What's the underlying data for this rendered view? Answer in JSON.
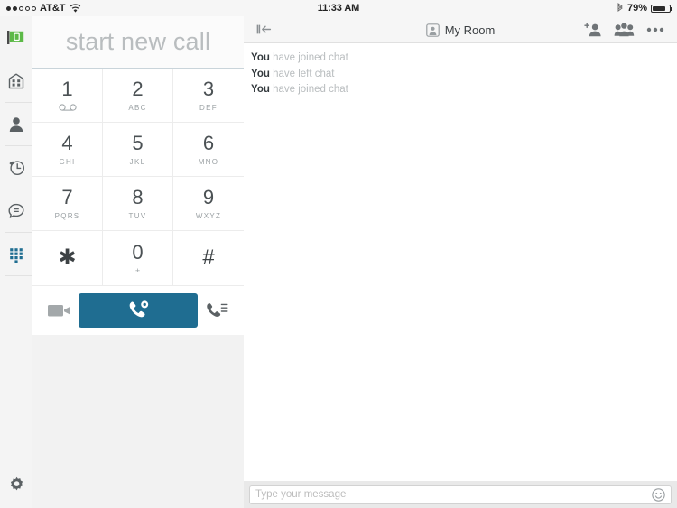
{
  "statusbar": {
    "carrier": "AT&T",
    "signal_dots_filled": 2,
    "signal_dots_total": 5,
    "wifi_icon": "wifi-icon",
    "time": "11:33 AM",
    "bluetooth_icon": "bluetooth-icon",
    "battery_percent": "79%",
    "battery_level": 79
  },
  "sidebar": {
    "items": [
      {
        "name": "app-logo",
        "label": "App Logo",
        "active": false
      },
      {
        "name": "enterprise-directory",
        "label": "Enterprise Directory",
        "active": false
      },
      {
        "name": "contacts",
        "label": "Contacts",
        "active": false
      },
      {
        "name": "call-history",
        "label": "Call History",
        "active": false
      },
      {
        "name": "messages",
        "label": "Messages",
        "active": false
      },
      {
        "name": "dialpad",
        "label": "Dialpad",
        "active": true
      }
    ],
    "settings": {
      "name": "settings",
      "label": "Settings"
    }
  },
  "dialer": {
    "display_placeholder": "start new call",
    "display_value": "",
    "keys": [
      {
        "digit": "1",
        "sub": "",
        "glyph": "voicemail-icon"
      },
      {
        "digit": "2",
        "sub": "ABC",
        "glyph": ""
      },
      {
        "digit": "3",
        "sub": "DEF",
        "glyph": ""
      },
      {
        "digit": "4",
        "sub": "GHI",
        "glyph": ""
      },
      {
        "digit": "5",
        "sub": "JKL",
        "glyph": ""
      },
      {
        "digit": "6",
        "sub": "MNO",
        "glyph": ""
      },
      {
        "digit": "7",
        "sub": "PQRS",
        "glyph": ""
      },
      {
        "digit": "8",
        "sub": "TUV",
        "glyph": ""
      },
      {
        "digit": "9",
        "sub": "WXYZ",
        "glyph": ""
      },
      {
        "digit": "✱",
        "sub": "",
        "glyph": ""
      },
      {
        "digit": "0",
        "sub": "+",
        "glyph": ""
      },
      {
        "digit": "#",
        "sub": "",
        "glyph": ""
      }
    ],
    "actions": {
      "video_call": "video-call-icon",
      "audio_call": "audio-call-icon",
      "call_options": "call-options-icon"
    }
  },
  "chat": {
    "collapse_label": "Collapse panel",
    "title": "My Room",
    "title_icon": "contact-card-icon",
    "header_actions": [
      {
        "name": "add-participant-icon",
        "label": "Add participant"
      },
      {
        "name": "group-participants-icon",
        "label": "Participants"
      },
      {
        "name": "more-options-icon",
        "label": "More options"
      }
    ],
    "messages": [
      {
        "author": "You",
        "text": "have joined chat"
      },
      {
        "author": "You",
        "text": "have left chat"
      },
      {
        "author": "You",
        "text": "have joined chat"
      }
    ],
    "composer": {
      "placeholder": "Type your message",
      "value": "",
      "emoji_icon": "emoji-smiley-icon"
    }
  },
  "colors": {
    "accent_blue": "#1f6d91",
    "logo_green": "#5cb947",
    "status_bar_bg": "#f6f6f6",
    "panel_bg": "#f2f2f2",
    "muted_text": "#b9bdbf"
  }
}
